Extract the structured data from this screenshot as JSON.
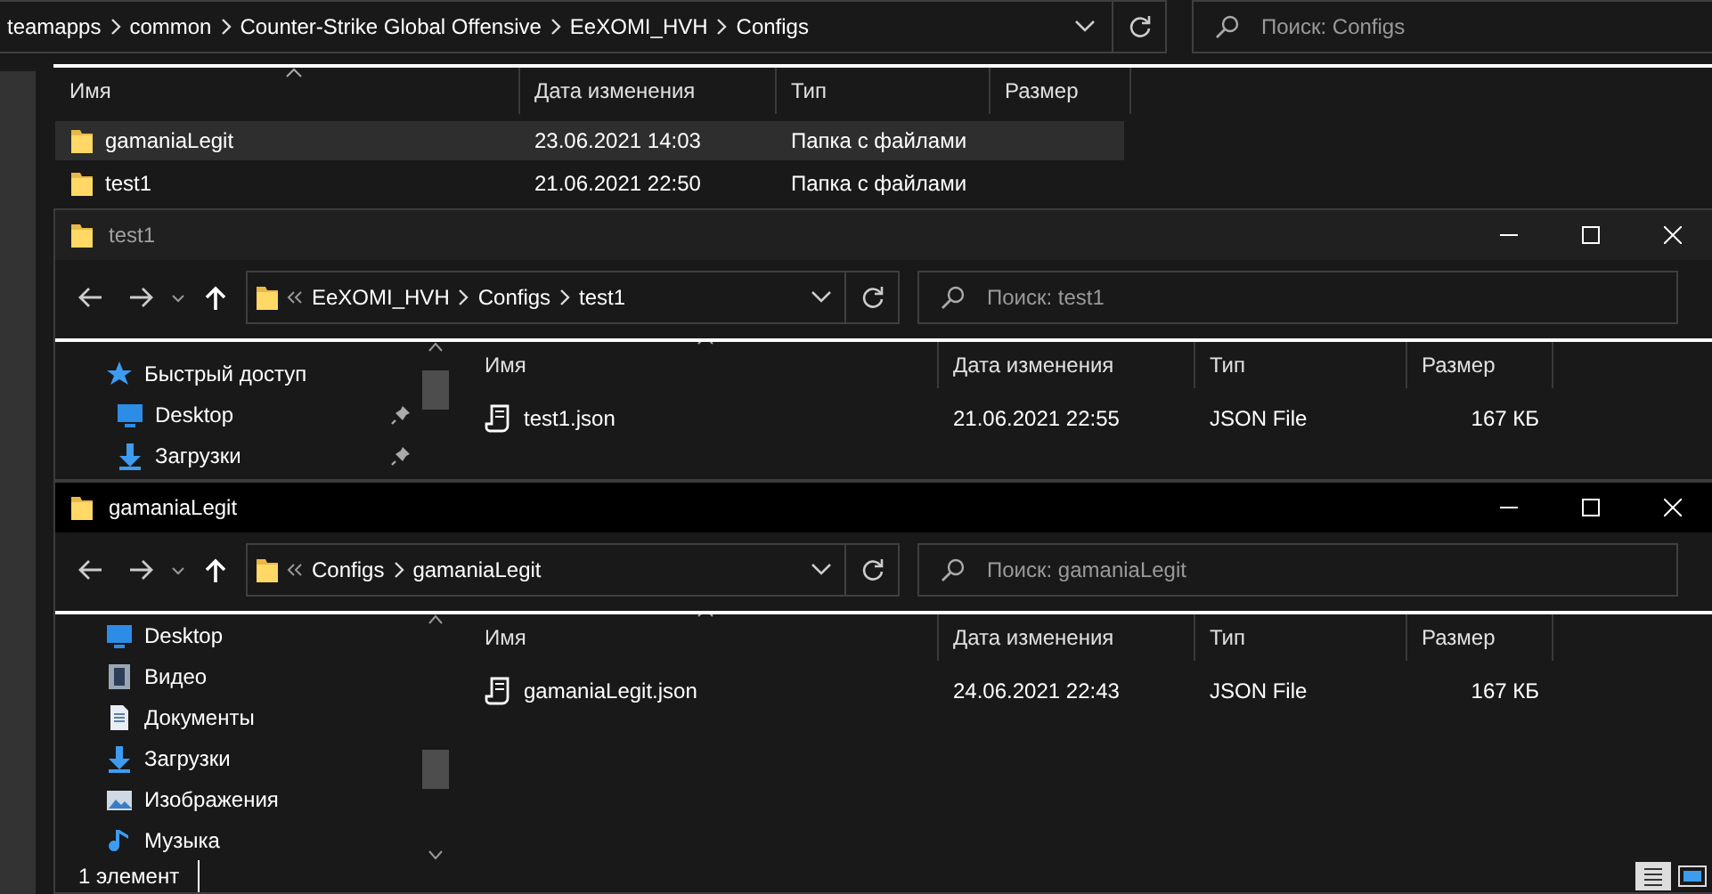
{
  "back_window": {
    "breadcrumbs": [
      "teamapps",
      "common",
      "Counter-Strike Global Offensive",
      "EeXOMI_HVH",
      "Configs"
    ],
    "search": {
      "placeholder": "Поиск: Configs"
    },
    "columns": [
      "Имя",
      "Дата изменения",
      "Тип",
      "Размер"
    ],
    "rows": [
      {
        "name": "gamaniaLegit",
        "date": "23.06.2021 14:03",
        "type": "Папка с файлами",
        "selected": true
      },
      {
        "name": "test1",
        "date": "21.06.2021 22:50",
        "type": "Папка с файлами",
        "selected": false
      }
    ]
  },
  "windows": [
    {
      "title": "test1",
      "active": false,
      "breadcrumbs": [
        "EeXOMI_HVH",
        "Configs",
        "test1"
      ],
      "search": {
        "placeholder": "Поиск: test1"
      },
      "nav_items": [
        {
          "label": "Быстрый доступ",
          "kind": "star",
          "pinned": false,
          "children": [
            {
              "label": "Desktop",
              "kind": "desktop",
              "pinned": true
            },
            {
              "label": "Загрузки",
              "kind": "downloads",
              "pinned": true
            }
          ]
        }
      ],
      "columns": [
        "Имя",
        "Дата изменения",
        "Тип",
        "Размер"
      ],
      "rows": [
        {
          "name": "test1.json",
          "date": "21.06.2021 22:55",
          "type": "JSON File",
          "size": "167 КБ"
        }
      ]
    },
    {
      "title": "gamaniaLegit",
      "active": true,
      "breadcrumbs": [
        "Configs",
        "gamaniaLegit"
      ],
      "search": {
        "placeholder": "Поиск: gamaniaLegit"
      },
      "nav_items": [
        {
          "label": "Desktop",
          "kind": "desktop",
          "pinned": false
        },
        {
          "label": "Видео",
          "kind": "video",
          "pinned": false
        },
        {
          "label": "Документы",
          "kind": "documents",
          "pinned": false
        },
        {
          "label": "Загрузки",
          "kind": "downloads",
          "pinned": false
        },
        {
          "label": "Изображения",
          "kind": "pictures",
          "pinned": false
        },
        {
          "label": "Музыка",
          "kind": "music",
          "pinned": false
        }
      ],
      "columns": [
        "Имя",
        "Дата изменения",
        "Тип",
        "Размер"
      ],
      "rows": [
        {
          "name": "gamaniaLegit.json",
          "date": "24.06.2021 22:43",
          "type": "JSON File",
          "size": "167 КБ"
        }
      ],
      "status_bar": "1 элемент"
    }
  ]
}
